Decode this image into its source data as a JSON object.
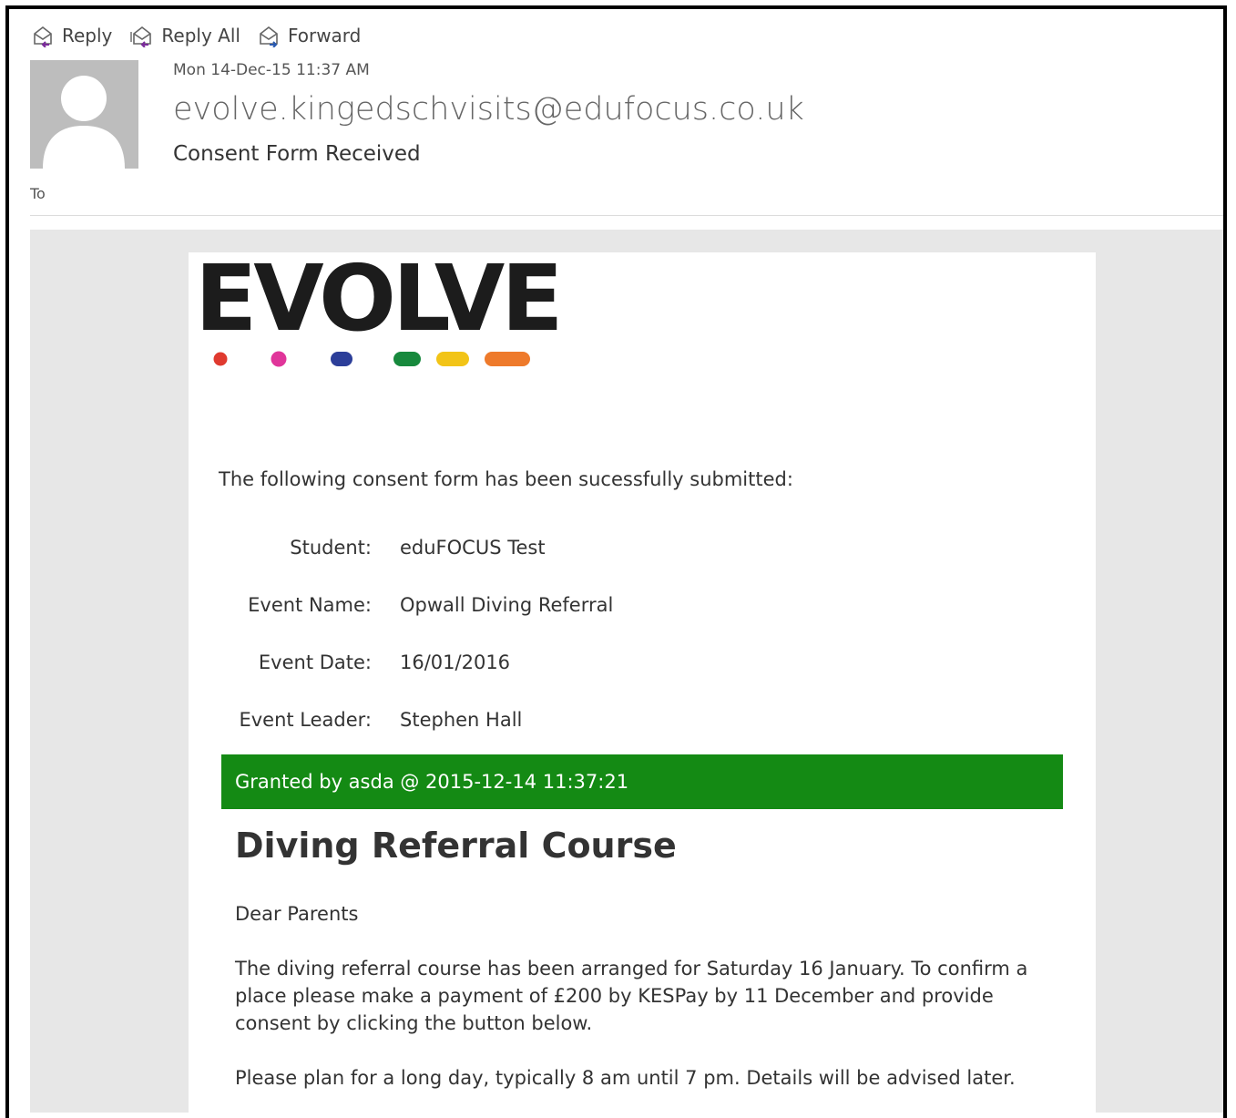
{
  "toolbar": {
    "reply": "Reply",
    "reply_all": "Reply All",
    "forward": "Forward"
  },
  "message": {
    "date": "Mon 14-Dec-15 11:37 AM",
    "sender": "evolve.kingedschvisits@edufocus.co.uk",
    "subject": "Consent Form Received",
    "to_label": "To"
  },
  "logo": {
    "text": "EVOLVE",
    "dot_colors": [
      "#e03a2f",
      "#e0359a",
      "#2c3e99",
      "#17893d",
      "#f2c417",
      "#ee7a2b"
    ]
  },
  "form": {
    "intro": "The following consent form has been sucessfully submitted:",
    "rows": [
      {
        "label": "Student:",
        "value": "eduFOCUS Test"
      },
      {
        "label": "Event Name:",
        "value": "Opwall Diving Referral"
      },
      {
        "label": "Event Date:",
        "value": "16/01/2016"
      },
      {
        "label": "Event Leader:",
        "value": "Stephen Hall"
      }
    ],
    "granted": "Granted by asda @ 2015-12-14 11:37:21",
    "granted_color": "#148a14"
  },
  "content": {
    "title": "Diving Referral Course",
    "greeting": "Dear Parents",
    "paragraph1": "The diving referral course has been arranged for Saturday 16 January. To confirm a place please make a payment of £200 by KESPay by 11 December and provide consent by clicking the button below.",
    "paragraph2": "Please plan for a long day, typically 8 am until 7 pm. Details will be advised later."
  }
}
